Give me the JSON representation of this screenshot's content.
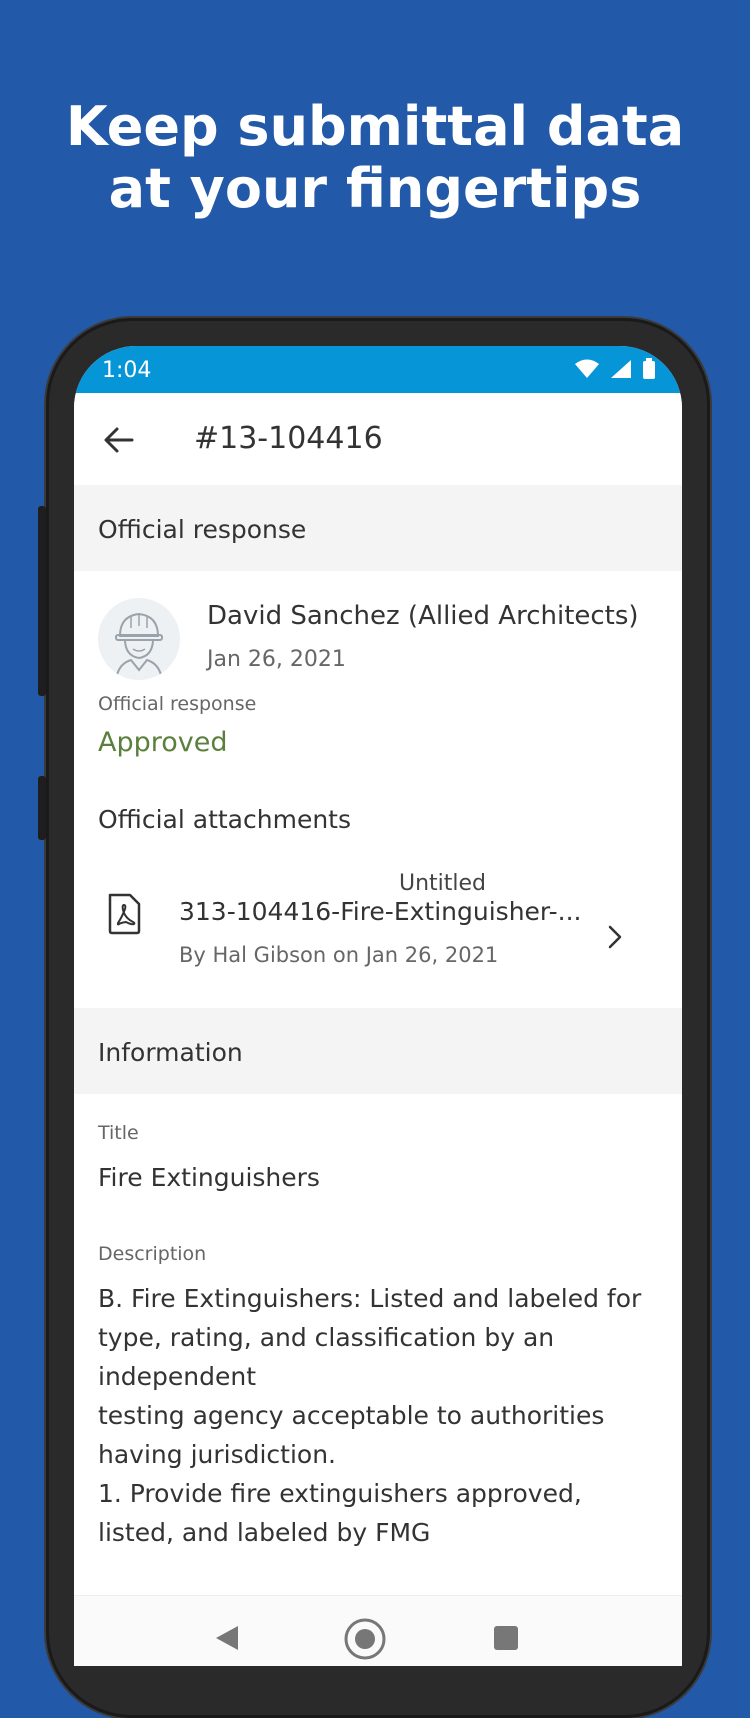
{
  "headline": {
    "line1": "Keep submittal data",
    "line2": "at your fingertips"
  },
  "status_bar": {
    "time": "1:04",
    "icons": [
      "wifi-icon",
      "signal-icon",
      "battery-icon"
    ]
  },
  "app_bar": {
    "title": "#13-104416",
    "back_icon": "arrow-left-icon"
  },
  "official_response_section": {
    "header": "Official response",
    "responder_name": "David Sanchez (Allied Architects)",
    "date": "Jan 26, 2021",
    "response_label": "Official response",
    "response_value": "Approved",
    "response_color": "#5b7f3c"
  },
  "attachments": {
    "title": "Official attachments",
    "items": [
      {
        "overlay_label": "Untitled",
        "filename": "313-104416-Fire-Extinguisher-...",
        "meta": "By Hal Gibson on Jan 26, 2021",
        "icon": "pdf-file-icon"
      }
    ]
  },
  "information_section": {
    "header": "Information",
    "title_label": "Title",
    "title_value": "Fire Extinguishers",
    "description_label": "Description",
    "description_value": "B. Fire Extinguishers: Listed and labeled for\ntype, rating, and classification by an\nindependent\ntesting agency acceptable to authorities\nhaving jurisdiction.\n1. Provide fire extinguishers approved,\nlisted, and labeled by FMG"
  },
  "colors": {
    "background": "#2259a8",
    "status_bar": "#0696d7",
    "approved": "#5b7f3c"
  }
}
